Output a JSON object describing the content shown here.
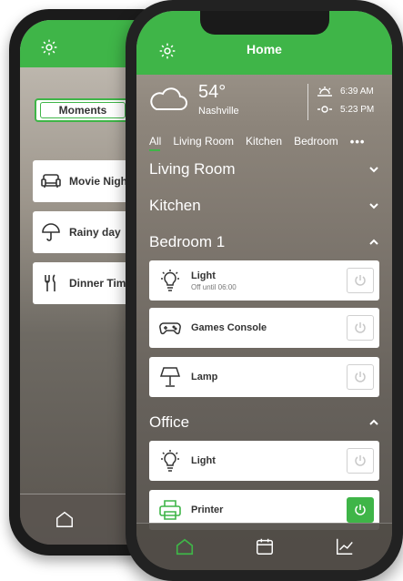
{
  "colors": {
    "accent": "#3fb548",
    "card": "#ffffff",
    "text": "#333333"
  },
  "back_phone": {
    "tab_active": "Moments",
    "moments": [
      {
        "label": "Movie Nigh",
        "icon": "sofa-icon"
      },
      {
        "label": "Rainy day",
        "icon": "umbrella-icon"
      },
      {
        "label": "Dinner Tim",
        "icon": "cutlery-icon"
      }
    ]
  },
  "front_phone": {
    "title": "Home",
    "weather": {
      "temp": "54°",
      "city": "Nashville",
      "sunrise": "6:39 AM",
      "sunset": "5:23 PM"
    },
    "room_tabs": [
      "All",
      "Living Room",
      "Kitchen",
      "Bedroom"
    ],
    "more": "•••",
    "sections": {
      "living_room": "Living Room",
      "kitchen": "Kitchen",
      "bedroom": "Bedroom 1",
      "office": "Office"
    },
    "bedroom_devices": [
      {
        "name": "Light",
        "sub": "Off until 06:00",
        "on": false
      },
      {
        "name": "Games Console",
        "on": false
      },
      {
        "name": "Lamp",
        "on": false
      }
    ],
    "office_devices": [
      {
        "name": "Light",
        "on": false
      },
      {
        "name": "Printer",
        "on": true
      }
    ]
  }
}
